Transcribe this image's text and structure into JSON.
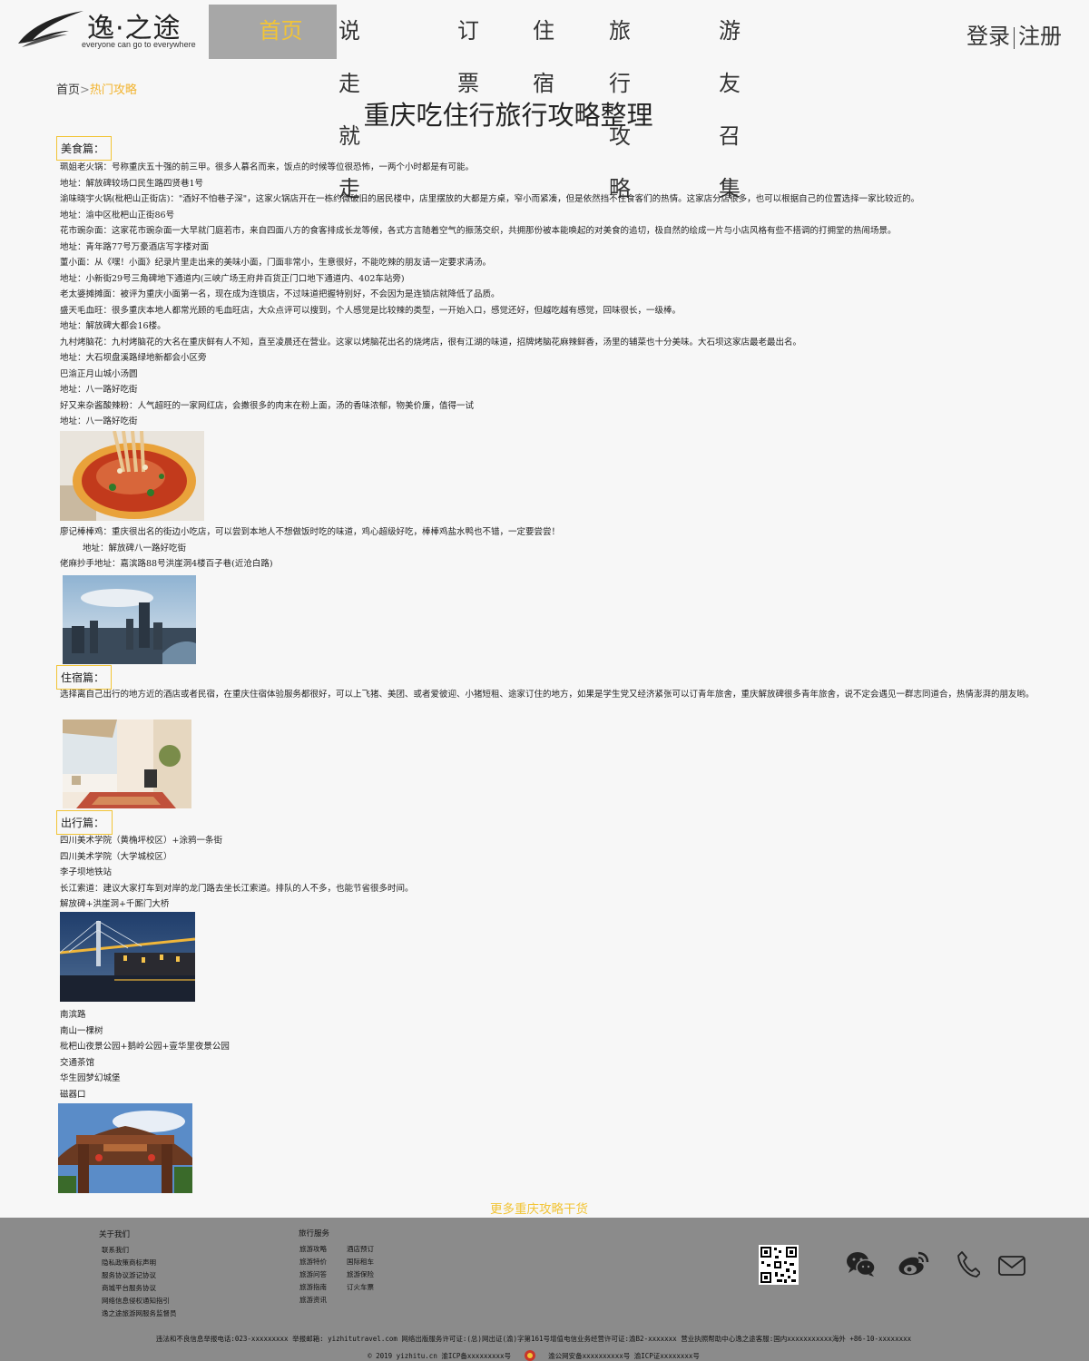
{
  "header": {
    "logo_text": "逸·之途",
    "logo_sub": "everyone can go to everywhere",
    "nav": [
      "首页",
      "说走就走",
      "订票",
      "住宿",
      "旅行攻略",
      "游友召集"
    ],
    "login": "登录",
    "register": "注册",
    "accent": "#f2c436"
  },
  "breadcrumb": {
    "home": "首页",
    "separator": ">",
    "current": "热门攻略"
  },
  "title": "重庆吃住行旅行攻略整理",
  "food": {
    "tag": "美食篇：",
    "lines": [
      "珮姐老火锅：号称重庆五十强的前三甲。很多人慕名而来，饭点的时候等位很恐怖，一两个小时都是有可能。",
      "地址：解放碑较场口民生路四贤巷1号",
      "渝味晓宇火锅(枇杷山正街店)：\"酒好不怕巷子深\"，这家火锅店开在一栋约微破旧的居民楼中，店里摆放的大都是方桌，窄小而紧凑，但是依然挡不住食客们的热情。这家店分店很多，也可以根据自己的位置选择一家比较近的。",
      "地址：渝中区枇杷山正街86号",
      "花市豌杂面：这家花市豌杂面一大早就门庭若市，来自四面八方的食客排成长龙等候，各式方言随着空气的振荡交织，共拥那份被本能唤起的对美食的追切，极自然的绘成一片与小店风格有些不搭调的打拥堂的热闹场景。",
      "地址：青年路77号万豪酒店写字楼对面",
      "董小面：从《嘿！小面》纪录片里走出来的美味小面，门面非常小，生意很好，不能吃辣的朋友请一定要求清汤。",
      "地址：小新街29号三角碑地下通道内(三峡广场王府井百货正门口地下通道内、402车站旁)",
      "老太婆摊摊面：被评为重庆小面第一名，现在成为连锁店，不过味道把握特别好，不会因为是连锁店就降低了品质。",
      "盛天毛血旺：很多重庆本地人都常光顾的毛血旺店，大众点评可以搜到，个人感觉是比较辣的类型，一开始入口，感觉还好，但越吃越有感觉，回味很长，一级棒。",
      "地址：解放碑大都会16楼。",
      "九村烤脑花：九村烤脑花的大名在重庆鲜有人不知，直至凌晨还在营业。这家以烤脑花出名的烧烤店，很有江湖的味道，招牌烤脑花麻辣鲜香，汤里的辅菜也十分美味。大石坝这家店最老最出名。",
      "地址：大石坝盘溪路绿地新都会小区旁",
      "巴渝正月山城小汤圆",
      "地址：八一路好吃街",
      "好又来杂酱酸辣粉：人气超旺的一家网红店，会撒很多的肉末在粉上面，汤的香味浓郁，物美价廉，值得一试",
      "地址：八一路好吃街"
    ],
    "lines_after": [
      "廖记棒棒鸡：重庆很出名的街边小吃店，可以尝到本地人不想做饭时吃的味道，鸡心超级好吃，棒棒鸡盐水鸭也不错，一定要尝尝！",
      "地址：解放碑八一路好吃街",
      "佬麻抄手地址：嘉滨路88号洪崖洞4楼百子巷(近沧白路)"
    ]
  },
  "stay": {
    "tag": "住宿篇：",
    "text": "选择离自己出行的地方近的酒店或者民宿，在重庆住宿体验服务都很好，可以上飞猪、美团、或者爱彼迎、小猪短租、途家订住的地方，如果是学生党又经济紧张可以订青年旅舍，重庆解放碑很多青年旅舍，说不定会遇见一群志同道合，热情澎湃的朋友哟。"
  },
  "travel": {
    "tag": "出行篇：",
    "lines": [
      "四川美术学院（黄桷坪校区）+涂鸦一条街",
      "四川美术学院（大学城校区）",
      "李子坝地铁站",
      "长江索道：建议大家打车到对岸的龙门路去坐长江索道。排队的人不多，也能节省很多时间。",
      "解放碑+洪崖洞+千厮门大桥"
    ],
    "lines_after": [
      "南滨路",
      "南山一棵树",
      "枇杷山夜景公园+鹅岭公园+壹华里夜景公园",
      "交通茶馆",
      "华生园梦幻城堡",
      "磁器口"
    ]
  },
  "more_link": "更多重庆攻略干货",
  "footer": {
    "about_title": "关于我们",
    "about_links": [
      "联系我们",
      "隐私政策商标声明",
      "服务协议游记协议",
      "商城平台服务协议",
      "网络信息侵权通知指引",
      "逸之途旅游网服务监督员"
    ],
    "service_title": "旅行服务",
    "service_col1": [
      "旅游攻略",
      "旅游特价",
      "旅游问答",
      "旅游指南",
      "旅游资讯"
    ],
    "service_col2": [
      "酒店预订",
      "国际租车",
      "旅游保险",
      "订火车票"
    ],
    "icons": [
      "wechat-icon",
      "weibo-icon",
      "phone-icon",
      "mail-icon"
    ],
    "legal1": "违法和不良信息举报电话:023-xxxxxxxxx 举报邮箱: yizhitutravel.com 网络出版服务许可证:(总)网出证(渝)字第161号增值电信业务经营许可证:渝B2-xxxxxxx 营业执照帮助中心逸之途客服:国内xxxxxxxxxxx海外 +86-10-xxxxxxxx",
    "legal2a": "© 2019 yizhitu.cn 渝ICP备xxxxxxxxx号",
    "legal2b": "渝公网安备xxxxxxxxxx号 渝ICP证xxxxxxxx号"
  }
}
